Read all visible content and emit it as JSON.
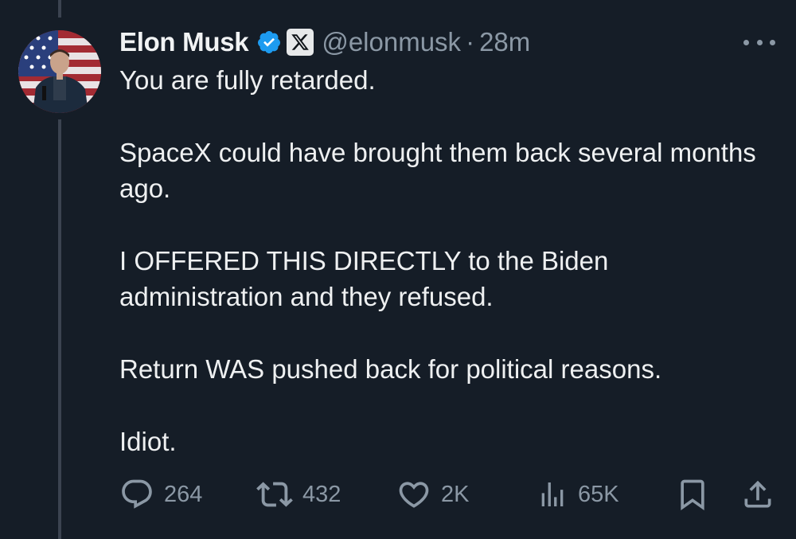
{
  "tweet": {
    "author_name": "Elon Musk",
    "handle": "@elonmusk",
    "separator": "·",
    "time": "28m",
    "paragraphs": [
      "You are fully retarded.",
      "SpaceX could have brought them back several months ago.",
      "I OFFERED THIS DIRECTLY to the Biden administration and they refused.",
      "Return WAS pushed back for political reasons.",
      "Idiot."
    ]
  },
  "actions": {
    "replies": "264",
    "reposts": "432",
    "likes": "2K",
    "views": "65K"
  },
  "icons": {
    "verified": "verified-badge-icon",
    "affiliate": "x-logo-icon",
    "more": "more-icon",
    "reply": "reply-icon",
    "repost": "repost-icon",
    "like": "heart-icon",
    "views": "views-icon",
    "bookmark": "bookmark-icon",
    "share": "share-icon"
  },
  "colors": {
    "background": "#151d27",
    "verified_blue": "#1d9bf0",
    "muted": "#8b98a5"
  }
}
